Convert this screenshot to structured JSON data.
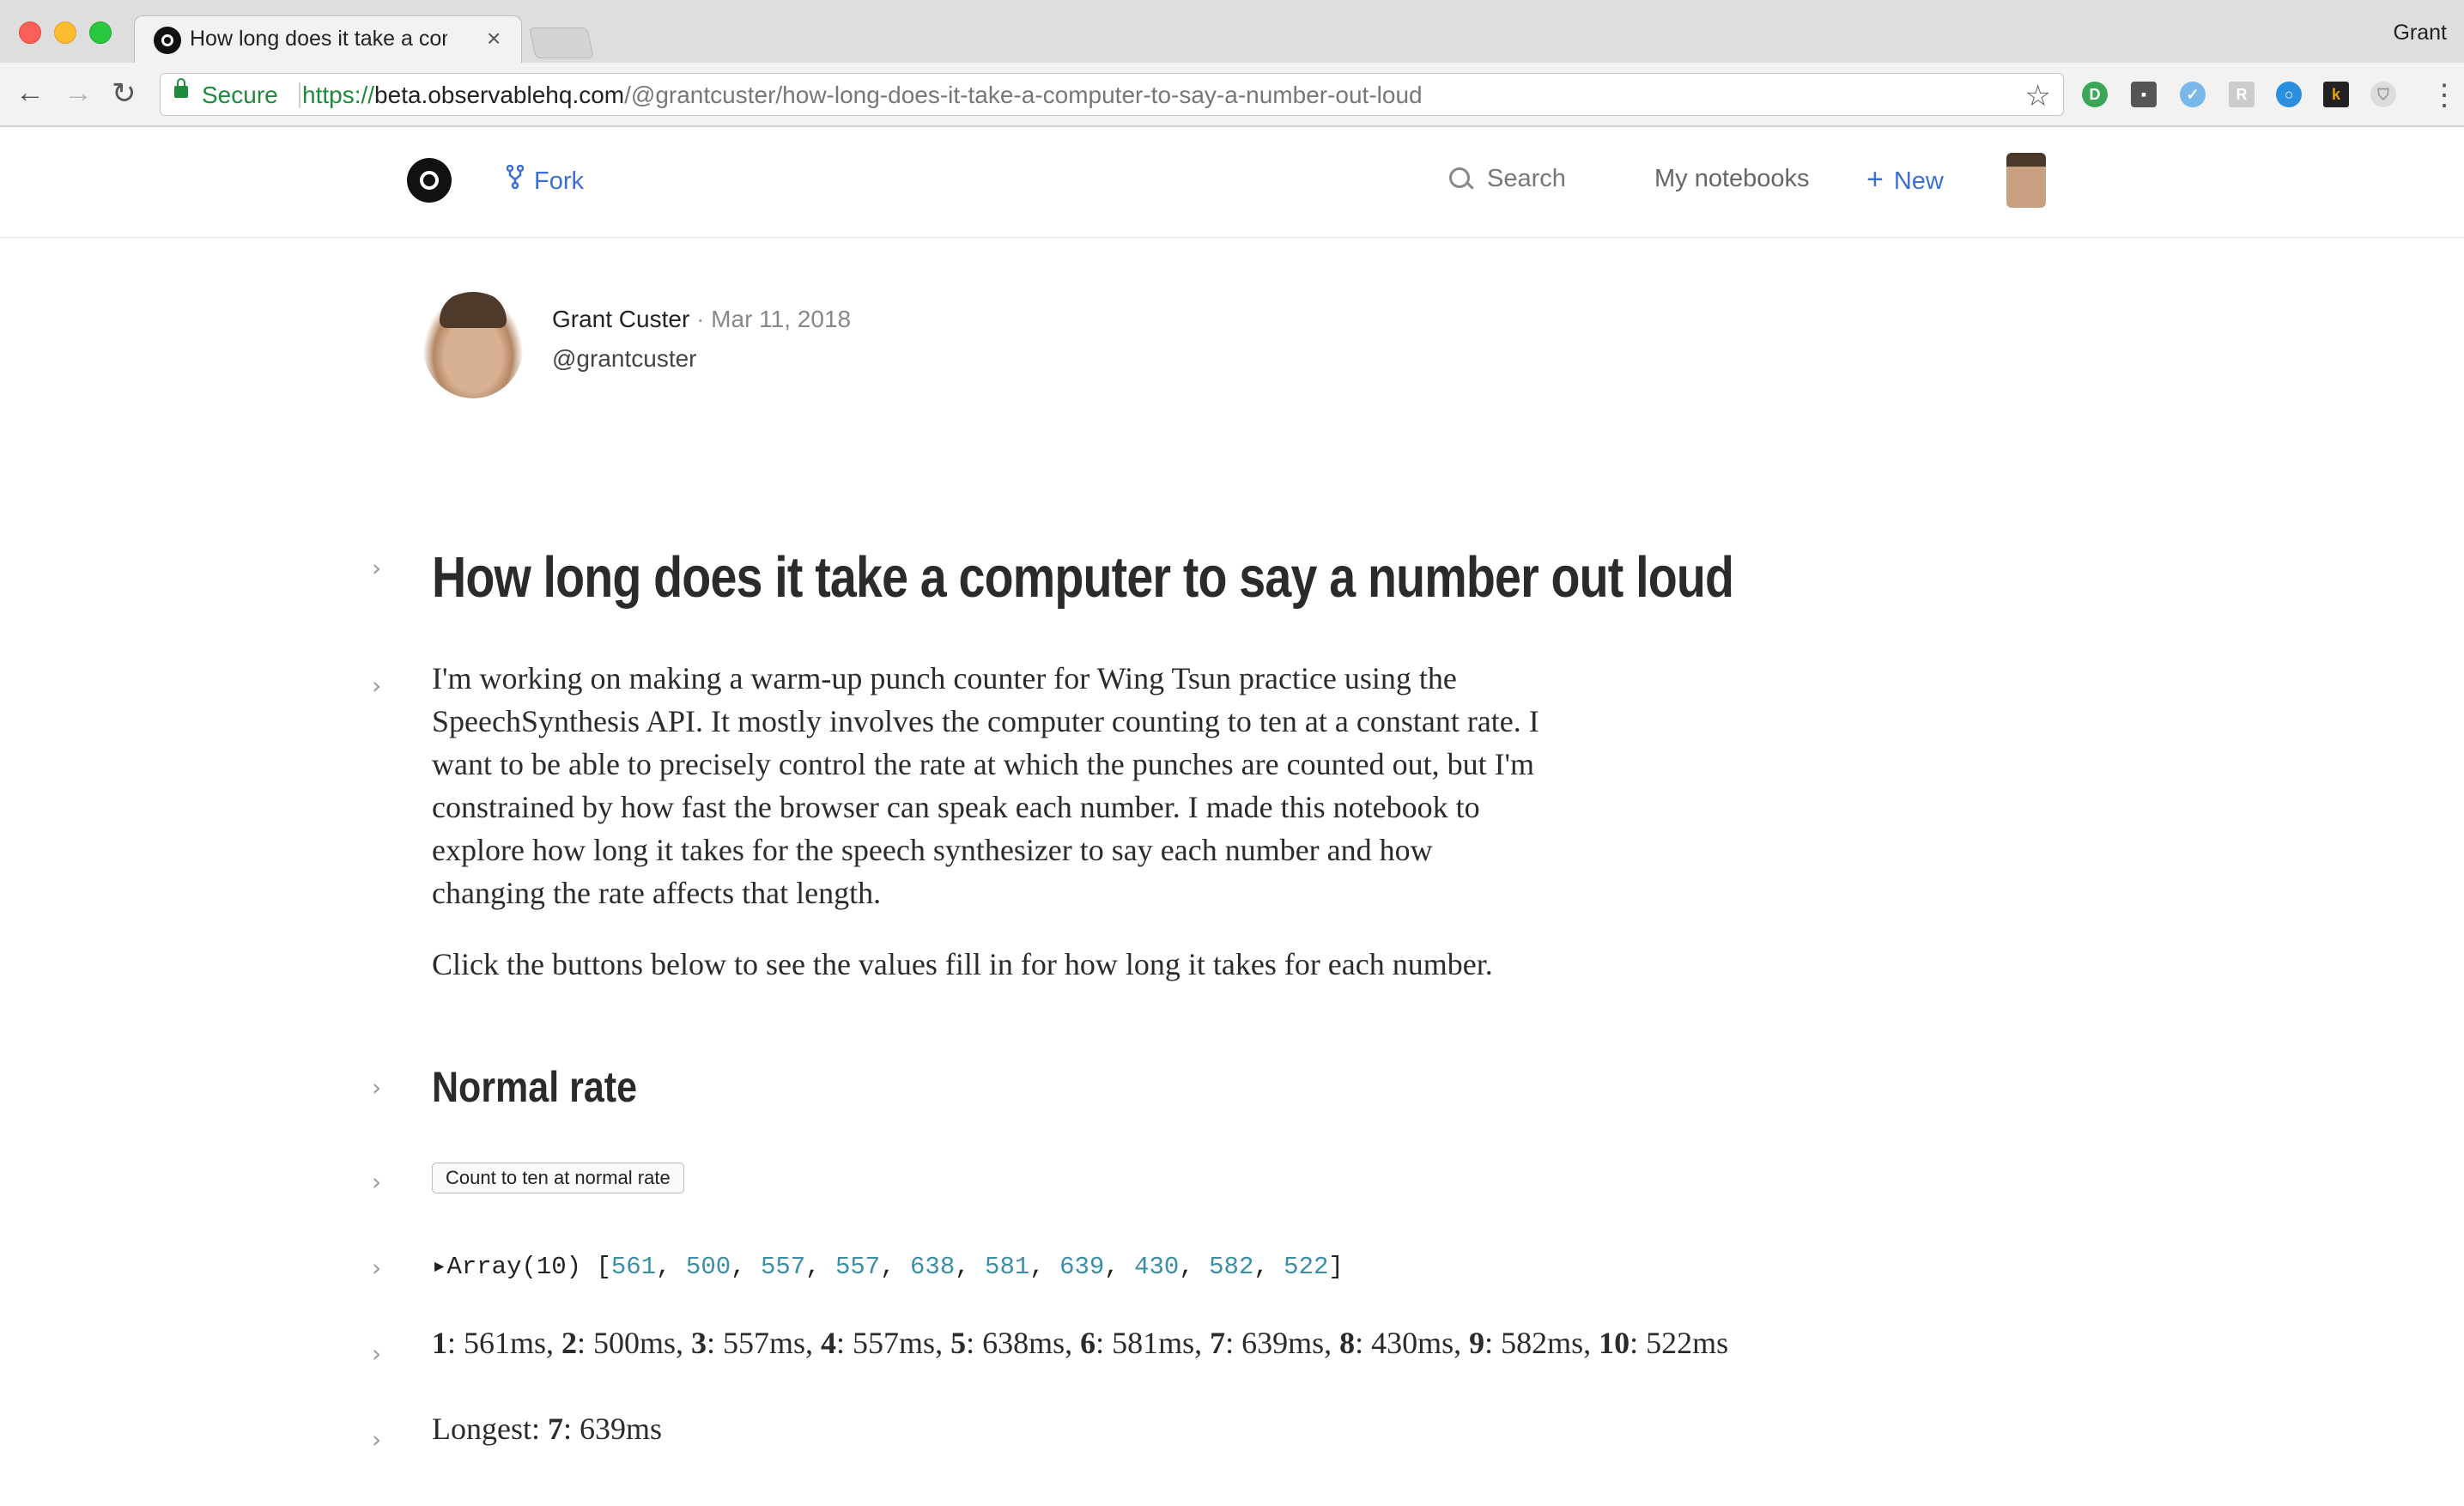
{
  "window": {
    "profile_name": "Grant"
  },
  "tab": {
    "title": "How long does it take a compu"
  },
  "address_bar": {
    "secure_label": "Secure",
    "scheme": "https://",
    "host": "beta.observablehq.com",
    "path": "/@grantcuster/how-long-does-it-take-a-computer-to-say-a-number-out-loud"
  },
  "header": {
    "fork_label": "Fork",
    "search_label": "Search",
    "my_notebooks_label": "My notebooks",
    "new_label": "New"
  },
  "author": {
    "name": "Grant Custer",
    "separator": "·",
    "date": "Mar 11, 2018",
    "handle": "@grantcuster"
  },
  "notebook": {
    "title": "How long does it take a computer to say a number out loud",
    "intro": "I'm working on making a warm-up punch counter for Wing Tsun practice using the SpeechSynthesis API. It mostly involves the computer counting to ten at a constant rate. I want to be able to precisely control the rate at which the punches are counted out, but I'm constrained by how fast the browser can speak each number. I made this notebook to explore how long it takes for the speech synthesizer to say each number and how changing the rate affects that length.",
    "instructions": "Click the buttons below to see the values fill in for how long it takes for each number.",
    "section_heading": "Normal rate",
    "button_label": "Count to ten at normal rate",
    "array_prefix": "▸Array(10) [",
    "array_values": [
      561,
      500,
      557,
      557,
      638,
      581,
      639,
      430,
      582,
      522
    ],
    "array_suffix": "]",
    "durations": [
      {
        "n": "1",
        "ms": "561ms"
      },
      {
        "n": "2",
        "ms": "500ms"
      },
      {
        "n": "3",
        "ms": "557ms"
      },
      {
        "n": "4",
        "ms": "557ms"
      },
      {
        "n": "5",
        "ms": "638ms"
      },
      {
        "n": "6",
        "ms": "581ms"
      },
      {
        "n": "7",
        "ms": "639ms"
      },
      {
        "n": "8",
        "ms": "430ms"
      },
      {
        "n": "9",
        "ms": "582ms"
      },
      {
        "n": "10",
        "ms": "522ms"
      }
    ],
    "longest_label": "Longest:",
    "longest_n": "7",
    "longest_ms": "639ms"
  },
  "colors": {
    "link": "#3b6fd4",
    "number": "#3a8fa8",
    "secure": "#1e8a3b"
  }
}
